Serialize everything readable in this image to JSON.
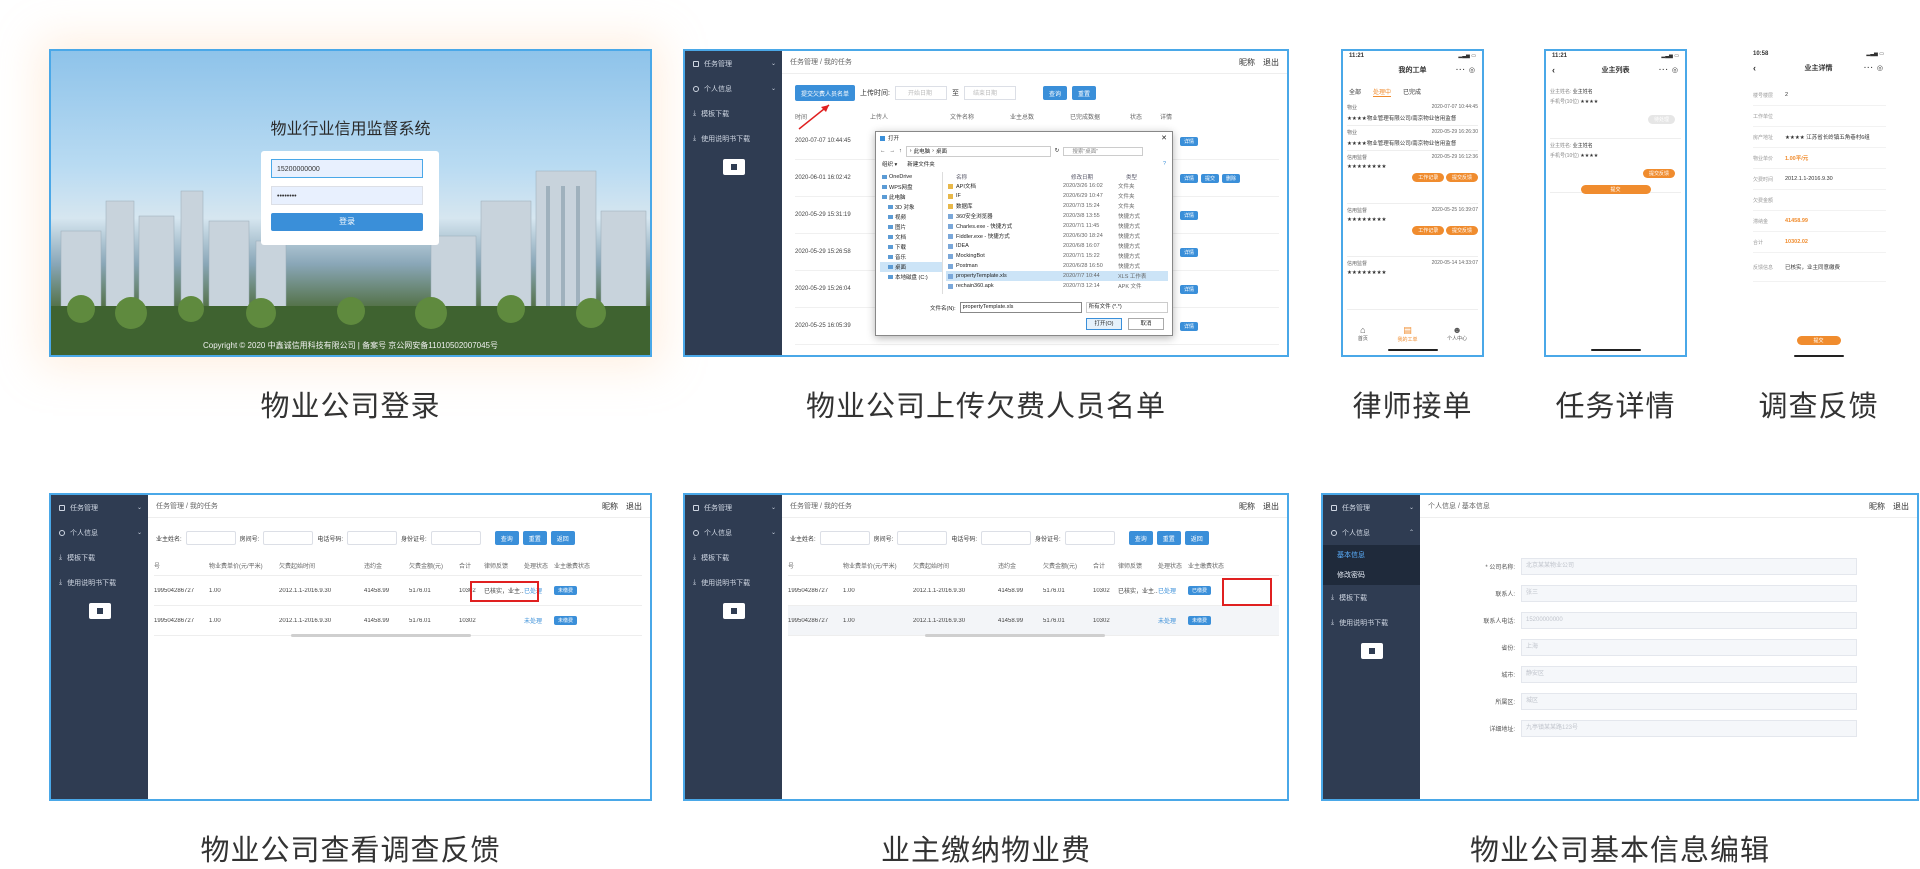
{
  "captions": [
    "物业公司登录",
    "物业公司上传欠费人员名单",
    "律师接单",
    "任务详情",
    "调查反馈",
    "物业公司查看调查反馈",
    "业主缴纳物业费",
    "物业公司基本信息编辑"
  ],
  "login": {
    "title": "物业行业信用监督系统",
    "phone": "15200000000",
    "password": "••••••••",
    "button": "登录",
    "footer": "Copyright © 2020 中鑫诚信用科技有限公司 | 备案号 京公网安备11010502007045号"
  },
  "admin": {
    "menu": [
      "任务管理",
      "个人信息",
      "模板下载",
      "使用说明书下载"
    ],
    "breadcrumb": [
      "任务管理",
      "我的任务"
    ],
    "top_right": [
      "昵称",
      "退出"
    ],
    "colors": {
      "sidebar": "#2f3c52",
      "primary": "#3a8fd9",
      "highlight": "#e02020"
    }
  },
  "upload": {
    "upload_button": "提交欠费人员名单",
    "time_label": "上传时间:",
    "start_ph": "开始日期",
    "to": "至",
    "end_ph": "结束日期",
    "query": "查询",
    "reset": "重置",
    "headers": [
      "时间",
      "上传人",
      "文件名称",
      "业主总数",
      "已完成数据",
      "状态",
      "详情"
    ],
    "rows": [
      "2020-07-07 10:44:45",
      "2020-06-01 16:02:42",
      "2020-05-29 15:31:19",
      "2020-05-29 15:26:58",
      "2020-05-29 15:26:04",
      "2020-05-25 16:05:39"
    ],
    "row_actions": [
      "详情",
      "详情 提交 删除",
      "详情",
      "详情",
      "详情",
      "详情"
    ],
    "dialog": {
      "title": "打开",
      "path": [
        "此电脑",
        "桌面"
      ],
      "search_ph": "搜索\"桌面\"",
      "organize": "组织 ▾",
      "new_folder": "新建文件夹",
      "nav": [
        "OneDrive",
        "WPS网盘",
        "此电脑",
        "3D 对象",
        "视频",
        "图片",
        "文档",
        "下载",
        "音乐",
        "桌面",
        "本地磁盘 (C:)"
      ],
      "col_headers": [
        "名称",
        "修改日期",
        "类型"
      ],
      "files": [
        {
          "name": "API文档",
          "date": "2020/3/26 16:02",
          "type": "文件夹"
        },
        {
          "name": "IF",
          "date": "2020/6/29 10:47",
          "type": "文件夹"
        },
        {
          "name": "数据库",
          "date": "2020/7/3 15:24",
          "type": "文件夹"
        },
        {
          "name": "360安全浏览器",
          "date": "2020/3/8 13:55",
          "type": "快捷方式"
        },
        {
          "name": "Charles.exe - 快捷方式",
          "date": "2020/7/1 11:45",
          "type": "快捷方式"
        },
        {
          "name": "Fiddler.exe - 快捷方式",
          "date": "2020/6/30 18:24",
          "type": "快捷方式"
        },
        {
          "name": "IDEA",
          "date": "2020/6/8 16:07",
          "type": "快捷方式"
        },
        {
          "name": "MockingBot",
          "date": "2020/7/1 15:22",
          "type": "快捷方式"
        },
        {
          "name": "Postman",
          "date": "2020/6/28 16:50",
          "type": "快捷方式"
        },
        {
          "name": "propertyTemplate.xls",
          "date": "2020/7/7 10:44",
          "type": "XLS 工作表"
        },
        {
          "name": "rechain360.apk",
          "date": "2020/7/3 12:14",
          "type": "APK 文件"
        }
      ],
      "filename_label": "文件名(N):",
      "filename": "propertyTemplate.xls",
      "filetype": "所有文件 (*.*)",
      "open": "打开(O)",
      "cancel": "取消"
    }
  },
  "lawyer": {
    "time": "11:21",
    "title": "我的工单",
    "tabs": [
      "全部",
      "处理中",
      "已完成"
    ],
    "orders": [
      {
        "type": "物业",
        "time": "2020-07-07 10:44:45",
        "company": "★★★★物业管理有限公司/南京物业信用监督"
      },
      {
        "type": "物业",
        "time": "2020-05-29 16:26:30",
        "company": "★★★★物业管理有限公司/南京物业信用监督"
      },
      {
        "type": "信用监督",
        "time": "2020-05-29 16:12:36",
        "company": "★★★★★★★★"
      },
      {
        "type": "信用监督",
        "time": "2020-05-25 16:39:07",
        "company": "★★★★★★★★"
      },
      {
        "type": "信用监督",
        "time": "2020-05-14 14:33:07",
        "company": "★★★★★★★★"
      }
    ],
    "order_buttons": [
      "工作记录",
      "提交反馈"
    ],
    "nav": [
      "首页",
      "我的工单",
      "个人中心"
    ]
  },
  "task": {
    "time": "11:21",
    "title": "业主列表",
    "items": [
      {
        "name_label": "业主姓名:",
        "name": "业主姓名",
        "phone_label": "手机号(10位)",
        "phone": "★★★★",
        "btn": "待处理"
      },
      {
        "name_label": "业主姓名:",
        "name": "业主姓名",
        "phone_label": "手机号(10位)",
        "phone": "★★★★",
        "btn": "提交反馈"
      }
    ],
    "submit": "提交"
  },
  "feedback": {
    "time": "10:58",
    "title": "业主详情",
    "fields": [
      {
        "label": "楼号楼层",
        "value": "2"
      },
      {
        "label": "工作单位",
        "value": ""
      },
      {
        "label": "房产地址",
        "value": "★★★★ 江苏省长岭镇五角巷村6组"
      },
      {
        "label": "物业单价",
        "value": "1.00平/元"
      },
      {
        "label": "欠费时间",
        "value": "2012.1.1-2016.9.30"
      },
      {
        "label": "欠费金额",
        "value": ""
      },
      {
        "label": "滞纳金",
        "value": "41458.99"
      },
      {
        "label": "合计",
        "value": "10302.02"
      },
      {
        "label": "反馈信息",
        "value": "已核实，业主同意缴费"
      }
    ],
    "submit": "提交"
  },
  "view": {
    "filters": [
      "业主姓名:",
      "房间号:",
      "电话号码:",
      "身份证号:"
    ],
    "buttons": [
      "查询",
      "重置",
      "返回"
    ],
    "headers": [
      "号",
      "物业费单价(元/平米)",
      "欠费起始时间",
      "违约金",
      "欠费金额(元)",
      "合计",
      "律师反馈",
      "处理状态",
      "业主缴费状态"
    ],
    "rows": [
      {
        "id": "199504286727",
        "price": "1.00",
        "period": "2012.1.1-2016.9.30",
        "fine": "41458.99",
        "amount": "5176.01",
        "total": "10302",
        "feedback": "已核实，业主...",
        "status": "已处理",
        "pay": "未缴费"
      },
      {
        "id": "199504286727",
        "price": "1.00",
        "period": "2012.1.1-2016.9.30",
        "fine": "41458.99",
        "amount": "5176.01",
        "total": "10302",
        "feedback": "",
        "status": "未处理",
        "pay": "未缴费"
      }
    ]
  },
  "pay": {
    "rows": [
      {
        "id": "199504286727",
        "price": "1.00",
        "period": "2012.1.1-2016.9.30",
        "fine": "41458.99",
        "amount": "5176.01",
        "total": "10302",
        "feedback": "已核实，业主...",
        "status": "已处理",
        "pay": "已缴费"
      },
      {
        "id": "199504286727",
        "price": "1.00",
        "period": "2012.1.1-2016.9.30",
        "fine": "41458.99",
        "amount": "5176.01",
        "total": "10302",
        "feedback": "",
        "status": "未处理",
        "pay": "未缴费"
      }
    ]
  },
  "info": {
    "breadcrumb": [
      "个人信息",
      "基本信息"
    ],
    "submenu": [
      "基本信息",
      "修改密码"
    ],
    "fields": [
      {
        "label": "* 公司名称:",
        "ph": "北京某某物业公司"
      },
      {
        "label": "联系人:",
        "ph": "张三"
      },
      {
        "label": "联系人电话:",
        "ph": "15200000000"
      },
      {
        "label": "省份:",
        "ph": "上海"
      },
      {
        "label": "城市:",
        "ph": "静安区"
      },
      {
        "label": "所属区:",
        "ph": "城区"
      },
      {
        "label": "详细地址:",
        "ph": "九亭镇某某路123号"
      }
    ]
  }
}
